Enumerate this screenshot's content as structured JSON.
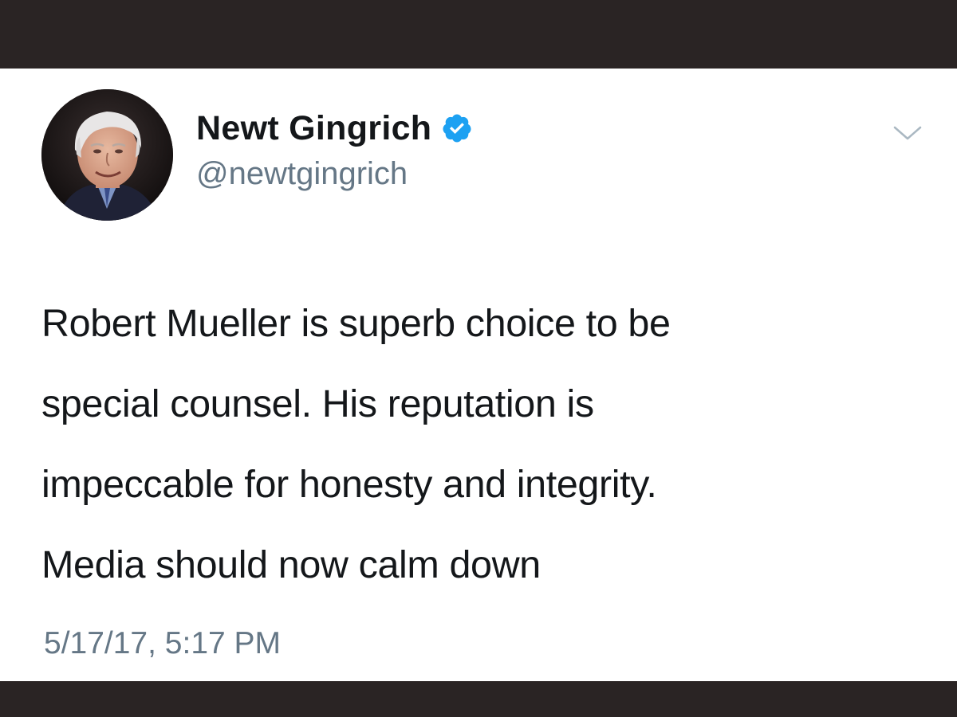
{
  "tweet": {
    "author": {
      "display_name": "Newt Gingrich",
      "handle": "@newtgingrich",
      "verified": true,
      "avatar_icon": "profile-photo"
    },
    "text_lines": [
      "Robert Mueller is superb choice to be",
      "special counsel. His reputation is",
      "impeccable for honesty and integrity.",
      "Media should now calm down"
    ],
    "timestamp": "5/17/17, 5:17 PM",
    "menu_icon": "chevron-down-icon"
  },
  "colors": {
    "frame": "#2a2424",
    "card": "#ffffff",
    "text_primary": "#14171a",
    "text_secondary": "#657786",
    "verified_badge": "#1da1f2"
  }
}
